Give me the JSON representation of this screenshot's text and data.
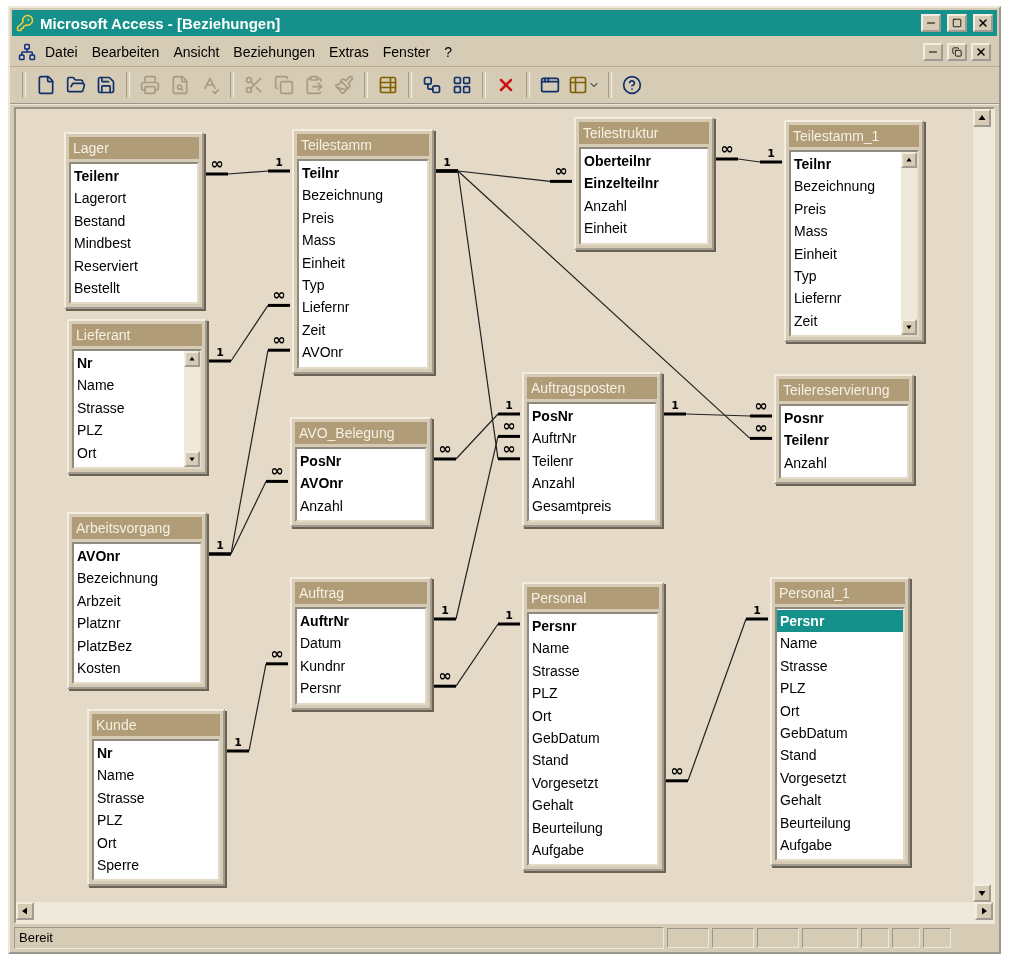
{
  "window": {
    "title": "Microsoft Access - [Beziehungen]"
  },
  "menu": [
    {
      "label": "Datei"
    },
    {
      "label": "Bearbeiten"
    },
    {
      "label": "Ansicht"
    },
    {
      "label": "Beziehungen"
    },
    {
      "label": "Extras"
    },
    {
      "label": "Fenster"
    },
    {
      "label": "?"
    }
  ],
  "toolbar": [
    [
      {
        "kind": "new",
        "disabled": false
      },
      {
        "kind": "open",
        "disabled": false
      },
      {
        "kind": "save",
        "disabled": false
      }
    ],
    [
      {
        "kind": "print",
        "disabled": true
      },
      {
        "kind": "preview",
        "disabled": true
      },
      {
        "kind": "spelling",
        "disabled": true
      }
    ],
    [
      {
        "kind": "cut",
        "disabled": true
      },
      {
        "kind": "copy",
        "disabled": true
      },
      {
        "kind": "paste",
        "disabled": true
      },
      {
        "kind": "format",
        "disabled": true
      }
    ],
    [
      {
        "kind": "show-table",
        "disabled": false
      }
    ],
    [
      {
        "kind": "direct",
        "disabled": false
      },
      {
        "kind": "all",
        "disabled": false
      }
    ],
    [
      {
        "kind": "delete",
        "disabled": false
      }
    ],
    [
      {
        "kind": "database",
        "disabled": false
      },
      {
        "kind": "new-object",
        "disabled": false
      }
    ],
    [
      {
        "kind": "help",
        "disabled": false
      }
    ]
  ],
  "tables": [
    {
      "title": "Lager",
      "scrollable": false,
      "fields": [
        {
          "name": "Teilenr",
          "key": true,
          "selected": false
        },
        {
          "name": "Lagerort",
          "key": false,
          "selected": false
        },
        {
          "name": "Bestand",
          "key": false,
          "selected": false
        },
        {
          "name": "Mindbest",
          "key": false,
          "selected": false
        },
        {
          "name": "Reserviert",
          "key": false,
          "selected": false
        },
        {
          "name": "Bestellt",
          "key": false,
          "selected": false
        }
      ]
    },
    {
      "title": "Teilestamm",
      "scrollable": false,
      "fields": [
        {
          "name": "Teilnr",
          "key": true,
          "selected": false
        },
        {
          "name": "Bezeichnung",
          "key": false,
          "selected": false
        },
        {
          "name": "Preis",
          "key": false,
          "selected": false
        },
        {
          "name": "Mass",
          "key": false,
          "selected": false
        },
        {
          "name": "Einheit",
          "key": false,
          "selected": false
        },
        {
          "name": "Typ",
          "key": false,
          "selected": false
        },
        {
          "name": "Liefernr",
          "key": false,
          "selected": false
        },
        {
          "name": "Zeit",
          "key": false,
          "selected": false
        },
        {
          "name": "AVOnr",
          "key": false,
          "selected": false
        }
      ]
    },
    {
      "title": "Teilestruktur",
      "scrollable": false,
      "fields": [
        {
          "name": "Oberteilnr",
          "key": true,
          "selected": false
        },
        {
          "name": "Einzelteilnr",
          "key": true,
          "selected": false
        },
        {
          "name": "Anzahl",
          "key": false,
          "selected": false
        },
        {
          "name": "Einheit",
          "key": false,
          "selected": false
        }
      ]
    },
    {
      "title": "Teilestamm_1",
      "scrollable": true,
      "fields": [
        {
          "name": "Teilnr",
          "key": true,
          "selected": false
        },
        {
          "name": "Bezeichnung",
          "key": false,
          "selected": false
        },
        {
          "name": "Preis",
          "key": false,
          "selected": false
        },
        {
          "name": "Mass",
          "key": false,
          "selected": false
        },
        {
          "name": "Einheit",
          "key": false,
          "selected": false
        },
        {
          "name": "Typ",
          "key": false,
          "selected": false
        },
        {
          "name": "Liefernr",
          "key": false,
          "selected": false
        },
        {
          "name": "Zeit",
          "key": false,
          "selected": false
        }
      ]
    },
    {
      "title": "Lieferant",
      "scrollable": true,
      "fields": [
        {
          "name": "Nr",
          "key": true,
          "selected": false
        },
        {
          "name": "Name",
          "key": false,
          "selected": false
        },
        {
          "name": "Strasse",
          "key": false,
          "selected": false
        },
        {
          "name": "PLZ",
          "key": false,
          "selected": false
        },
        {
          "name": "Ort",
          "key": false,
          "selected": false
        }
      ]
    },
    {
      "title": "AVO_Belegung",
      "scrollable": false,
      "fields": [
        {
          "name": "PosNr",
          "key": true,
          "selected": false
        },
        {
          "name": "AVOnr",
          "key": true,
          "selected": false
        },
        {
          "name": "Anzahl",
          "key": false,
          "selected": false
        }
      ]
    },
    {
      "title": "Auftragsposten",
      "scrollable": false,
      "fields": [
        {
          "name": "PosNr",
          "key": true,
          "selected": false
        },
        {
          "name": "AuftrNr",
          "key": false,
          "selected": false
        },
        {
          "name": "Teilenr",
          "key": false,
          "selected": false
        },
        {
          "name": "Anzahl",
          "key": false,
          "selected": false
        },
        {
          "name": "Gesamtpreis",
          "key": false,
          "selected": false
        }
      ]
    },
    {
      "title": "Teilereservierung",
      "scrollable": false,
      "fields": [
        {
          "name": "Posnr",
          "key": true,
          "selected": false
        },
        {
          "name": "Teilenr",
          "key": true,
          "selected": false
        },
        {
          "name": "Anzahl",
          "key": false,
          "selected": false
        }
      ]
    },
    {
      "title": "Arbeitsvorgang",
      "scrollable": false,
      "fields": [
        {
          "name": "AVOnr",
          "key": true,
          "selected": false
        },
        {
          "name": "Bezeichnung",
          "key": false,
          "selected": false
        },
        {
          "name": "Arbzeit",
          "key": false,
          "selected": false
        },
        {
          "name": "Platznr",
          "key": false,
          "selected": false
        },
        {
          "name": "PlatzBez",
          "key": false,
          "selected": false
        },
        {
          "name": "Kosten",
          "key": false,
          "selected": false
        }
      ]
    },
    {
      "title": "Auftrag",
      "scrollable": false,
      "fields": [
        {
          "name": "AuftrNr",
          "key": true,
          "selected": false
        },
        {
          "name": "Datum",
          "key": false,
          "selected": false
        },
        {
          "name": "Kundnr",
          "key": false,
          "selected": false
        },
        {
          "name": "Persnr",
          "key": false,
          "selected": false
        }
      ]
    },
    {
      "title": "Personal",
      "scrollable": false,
      "fields": [
        {
          "name": "Persnr",
          "key": true,
          "selected": false
        },
        {
          "name": "Name",
          "key": false,
          "selected": false
        },
        {
          "name": "Strasse",
          "key": false,
          "selected": false
        },
        {
          "name": "PLZ",
          "key": false,
          "selected": false
        },
        {
          "name": "Ort",
          "key": false,
          "selected": false
        },
        {
          "name": "GebDatum",
          "key": false,
          "selected": false
        },
        {
          "name": "Stand",
          "key": false,
          "selected": false
        },
        {
          "name": "Vorgesetzt",
          "key": false,
          "selected": false
        },
        {
          "name": "Gehalt",
          "key": false,
          "selected": false
        },
        {
          "name": "Beurteilung",
          "key": false,
          "selected": false
        },
        {
          "name": "Aufgabe",
          "key": false,
          "selected": false
        }
      ]
    },
    {
      "title": "Personal_1",
      "scrollable": false,
      "fields": [
        {
          "name": "Persnr",
          "key": true,
          "selected": true
        },
        {
          "name": "Name",
          "key": false,
          "selected": false
        },
        {
          "name": "Strasse",
          "key": false,
          "selected": false
        },
        {
          "name": "PLZ",
          "key": false,
          "selected": false
        },
        {
          "name": "Ort",
          "key": false,
          "selected": false
        },
        {
          "name": "GebDatum",
          "key": false,
          "selected": false
        },
        {
          "name": "Stand",
          "key": false,
          "selected": false
        },
        {
          "name": "Vorgesetzt",
          "key": false,
          "selected": false
        },
        {
          "name": "Gehalt",
          "key": false,
          "selected": false
        },
        {
          "name": "Beurteilung",
          "key": false,
          "selected": false
        },
        {
          "name": "Aufgabe",
          "key": false,
          "selected": false
        }
      ]
    },
    {
      "title": "Kunde",
      "scrollable": false,
      "fields": [
        {
          "name": "Nr",
          "key": true,
          "selected": false
        },
        {
          "name": "Name",
          "key": false,
          "selected": false
        },
        {
          "name": "Strasse",
          "key": false,
          "selected": false
        },
        {
          "name": "PLZ",
          "key": false,
          "selected": false
        },
        {
          "name": "Ort",
          "key": false,
          "selected": false
        },
        {
          "name": "Sperre",
          "key": false,
          "selected": false
        }
      ]
    }
  ],
  "relationships": [
    {
      "from_label": "∞",
      "to_label": "1"
    },
    {
      "from_label": "∞",
      "to_label": "1"
    },
    {
      "from_label": "1",
      "to_label": "∞"
    },
    {
      "from_label": "1",
      "to_label": "∞"
    },
    {
      "from_label": "1",
      "to_label": "∞"
    },
    {
      "from_label": "∞",
      "to_label": "1"
    },
    {
      "from_label": "1",
      "to_label": "∞"
    },
    {
      "from_label": "1",
      "to_label": "∞"
    },
    {
      "to_label": "∞"
    },
    {
      "to_label": "∞"
    },
    {
      "to_label": "∞"
    },
    {
      "from_label": "∞",
      "to_label": "1"
    },
    {
      "from_label": "∞",
      "to_label": "1"
    },
    {
      "from_label": "1",
      "to_label": "∞"
    }
  ],
  "status_bar": {
    "text": "Bereit"
  }
}
